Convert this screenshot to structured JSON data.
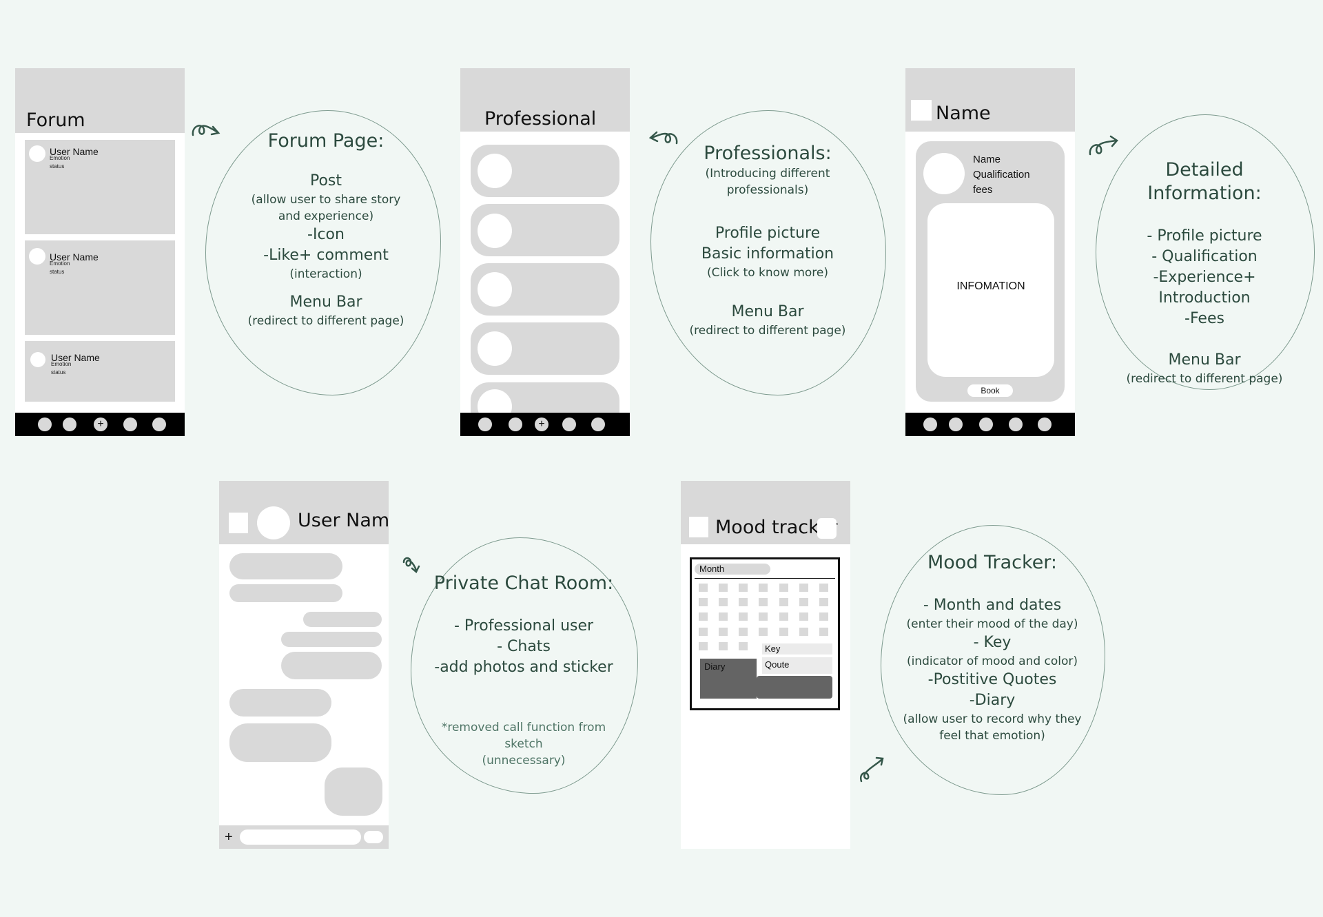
{
  "forum": {
    "title": "Forum",
    "posts": [
      {
        "user": "User Name",
        "emotion": "Emotion",
        "status": "status"
      },
      {
        "user": "User Name",
        "emotion": "Emotion",
        "status": "status"
      },
      {
        "user": "User Name",
        "emotion": "Emotion",
        "status": "status"
      }
    ],
    "nav_add": "+"
  },
  "forum_note": {
    "heading": "Forum Page:",
    "post": "Post",
    "post_desc": "(allow user to share story and experience)",
    "icon": "-Icon",
    "like": "-Like+ comment",
    "interaction": "(interaction)",
    "menu": "Menu Bar",
    "menu_desc": "(redirect to different page)"
  },
  "professional": {
    "title": "Professional",
    "nav_add": "+"
  },
  "professional_note": {
    "heading": "Professionals:",
    "heading_desc": "(Introducing different professionals)",
    "profile": "Profile picture",
    "basic": "Basic information",
    "click": "(Click to know more)",
    "menu": "Menu Bar",
    "menu_desc": "(redirect to different page)"
  },
  "detail": {
    "title": "Name",
    "name": "Name",
    "qualification": "Qualification",
    "fees": "fees",
    "info": "INFOMATION",
    "book": "Book"
  },
  "detail_note": {
    "heading": "Detailed Information:",
    "l1": "- Profile picture",
    "l2": "- Qualification",
    "l3": "-Experience+ Introduction",
    "l4": "-Fees",
    "menu": "Menu Bar",
    "menu_desc": "(redirect to different page)"
  },
  "chat": {
    "title": "User Name",
    "add": "+"
  },
  "chat_note": {
    "heading": "Private Chat Room:",
    "l1": "- Professional user",
    "l2": "- Chats",
    "l3": "-add photos and sticker",
    "removed": "*removed call function from sketch",
    "unnecessary": "(unnecessary)"
  },
  "mood": {
    "title": "Mood tracker",
    "month": "Month",
    "key": "Key",
    "quote": "Qoute",
    "diary": "Diary"
  },
  "mood_note": {
    "heading": "Mood Tracker:",
    "l1": "- Month and dates",
    "l1_desc": "(enter their mood of the day)",
    "l2": "- Key",
    "l2_desc": "(indicator of mood and color)",
    "l3": "-Postitive Quotes",
    "l4": "-Diary",
    "l4_desc": "(allow user to record why they feel that emotion)"
  },
  "colors": {
    "background": "#f1f7f4",
    "placeholder": "#d9d9d9",
    "note_text": "#2c4a3e",
    "outline": "#7d9a8e"
  }
}
